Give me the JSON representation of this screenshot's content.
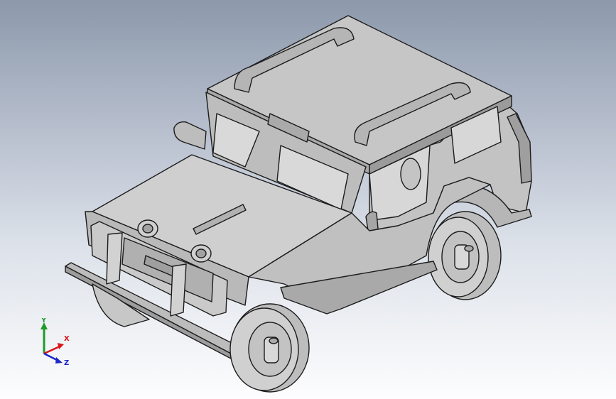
{
  "viewport": {
    "background_top": "#8c99ab",
    "background_bottom": "#fdfdfe",
    "model_fill": "#c9c9c9",
    "model_face_light": "#d6d6d6",
    "model_face_dark": "#9d9d9d",
    "edge_color": "#1c1c1c"
  },
  "triad": {
    "x_label": "X",
    "y_label": "Y",
    "z_label": "Z",
    "x_color": "#d9141b",
    "y_color": "#1f9a2a",
    "z_color": "#1d27c8"
  }
}
